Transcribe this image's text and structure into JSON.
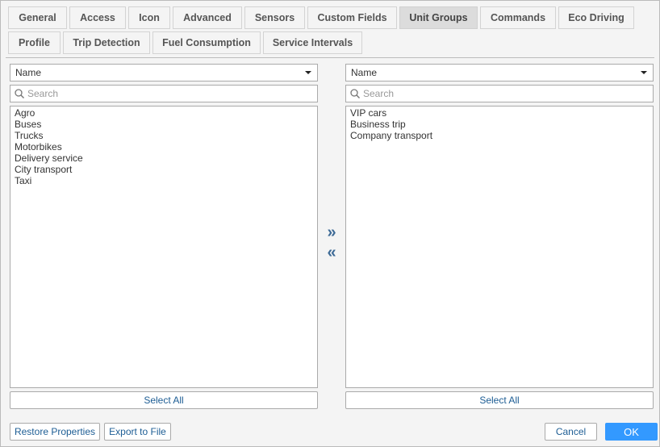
{
  "tabs": {
    "row1": [
      "General",
      "Access",
      "Icon",
      "Advanced",
      "Sensors",
      "Custom Fields",
      "Unit Groups",
      "Commands",
      "Eco Driving"
    ],
    "row2": [
      "Profile",
      "Trip Detection",
      "Fuel Consumption",
      "Service Intervals"
    ],
    "active": "Unit Groups"
  },
  "left": {
    "sort": "Name",
    "search_placeholder": "Search",
    "items": [
      "Agro",
      "Buses",
      "Trucks",
      "Motorbikes",
      "Delivery service",
      "City transport",
      "Taxi"
    ],
    "select_all": "Select All"
  },
  "right": {
    "sort": "Name",
    "search_placeholder": "Search",
    "items": [
      "VIP cars",
      "Business trip",
      "Company transport"
    ],
    "select_all": "Select All"
  },
  "arrows": {
    "add": "»",
    "remove": "«"
  },
  "footer": {
    "restore": "Restore Properties",
    "export": "Export to File",
    "cancel": "Cancel",
    "ok": "OK"
  }
}
